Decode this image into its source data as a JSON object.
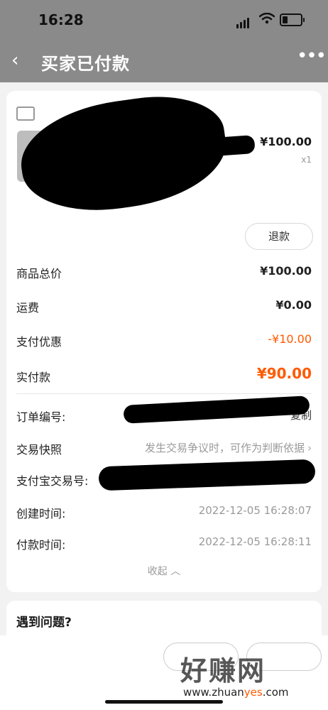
{
  "status_bar": {
    "time": "16:28"
  },
  "nav": {
    "back_glyph": "‹",
    "title": "买家已付款",
    "more_glyph": "•••"
  },
  "product": {
    "price": "¥100.00",
    "qty": "x1",
    "refund_label": "退款"
  },
  "summary": [
    {
      "label": "商品总价",
      "value": "¥100.00"
    },
    {
      "label": "运费",
      "value": "¥0.00"
    },
    {
      "label": "支付优惠",
      "value": "-¥10.00"
    },
    {
      "label": "实付款",
      "value": "¥90.00"
    }
  ],
  "order_info": {
    "order_no_label": "订单编号:",
    "copy_label": "复制",
    "snapshot_label": "交易快照",
    "snapshot_value": "发生交易争议时，可作为判断依据",
    "alipay_label": "支付宝交易号:",
    "created_label": "创建时间:",
    "created_value": "2022-12-05 16:28:07",
    "paid_label": "付款时间:",
    "paid_value": "2022-12-05 16:28:11",
    "collapse_label": "收起",
    "collapse_glyph": "︿"
  },
  "problem": {
    "title": "遇到问题?"
  },
  "bottom_bar": {
    "button1_label": "",
    "button2_label": ""
  },
  "watermark": {
    "logo_text": "好赚网",
    "url_prefix": "www.zhuan",
    "url_highlight": "yes",
    "url_suffix": ".com"
  },
  "icons": {
    "shop": "shop-icon",
    "chevron_right": "›"
  },
  "colors": {
    "accent": "#ff5a00",
    "header_bg": "#8a8a8a"
  }
}
